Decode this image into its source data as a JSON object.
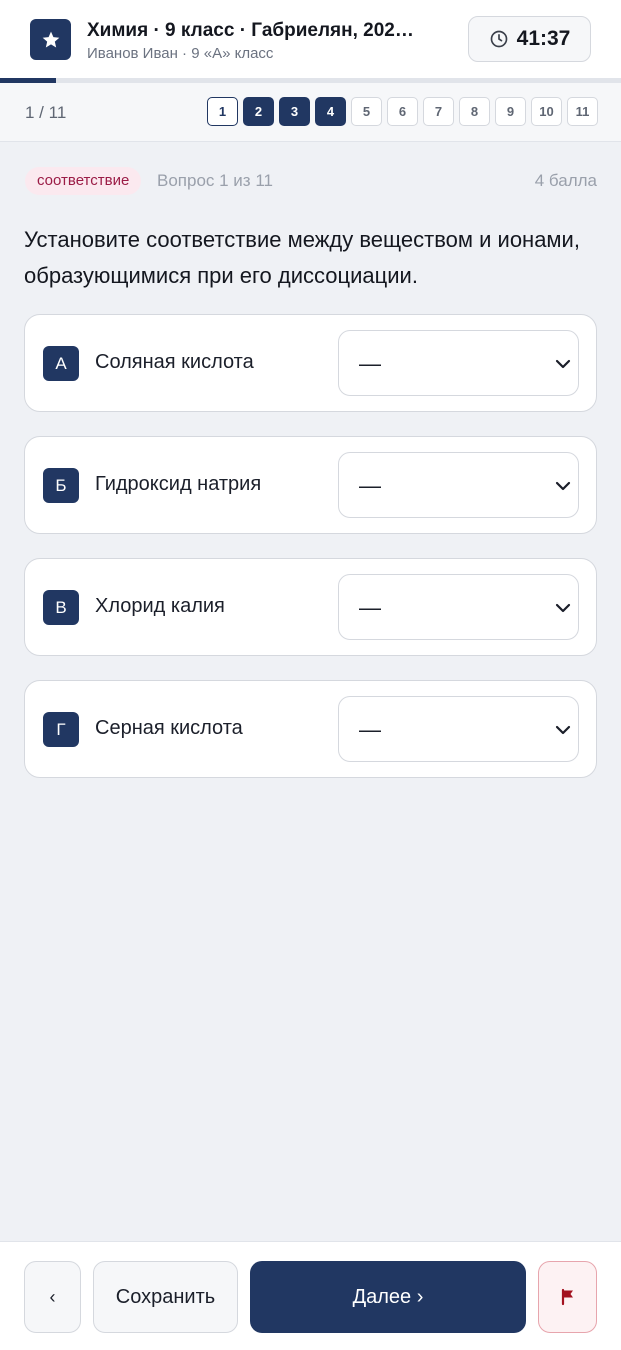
{
  "header": {
    "title": "Химия · 9 класс · Габриелян, 202…",
    "subtitle": "Иванов Иван · 9 «А» класс",
    "timer": "41:37",
    "logo_icon": "star-icon",
    "timer_icon": "clock-icon"
  },
  "progress": {
    "fraction": 0.09
  },
  "pager": {
    "counter": "1 / 11",
    "pages": [
      {
        "label": "1",
        "state": "current"
      },
      {
        "label": "2",
        "state": "answered"
      },
      {
        "label": "3",
        "state": "answered"
      },
      {
        "label": "4",
        "state": "answered"
      },
      {
        "label": "5",
        "state": "default"
      },
      {
        "label": "6",
        "state": "default"
      },
      {
        "label": "7",
        "state": "default"
      },
      {
        "label": "8",
        "state": "default"
      },
      {
        "label": "9",
        "state": "default"
      },
      {
        "label": "10",
        "state": "default"
      },
      {
        "label": "11",
        "state": "default"
      }
    ]
  },
  "question": {
    "type_tag": "соответствие",
    "number": "Вопрос 1 из 11",
    "points": "4 балла",
    "text": "Установите соответствие между веществом и ионами, образующимися при его диссоциации.",
    "items": [
      {
        "letter": "А",
        "label": "Соляная кислота",
        "value": "—"
      },
      {
        "letter": "Б",
        "label": "Гидроксид натрия",
        "value": "—"
      },
      {
        "letter": "В",
        "label": "Хлорид калия",
        "value": "—"
      },
      {
        "letter": "Г",
        "label": "Серная кислота",
        "value": "—"
      }
    ]
  },
  "footer": {
    "prev_label": "‹",
    "save_label": "Сохранить",
    "next_label": "Далее ›",
    "flag_icon": "flag-icon"
  },
  "colors": {
    "accent": "#213762",
    "tag_bg": "#fbe9ef",
    "tag_text": "#9b1c46",
    "flag": "#a3121f",
    "background": "#eff1f5"
  }
}
